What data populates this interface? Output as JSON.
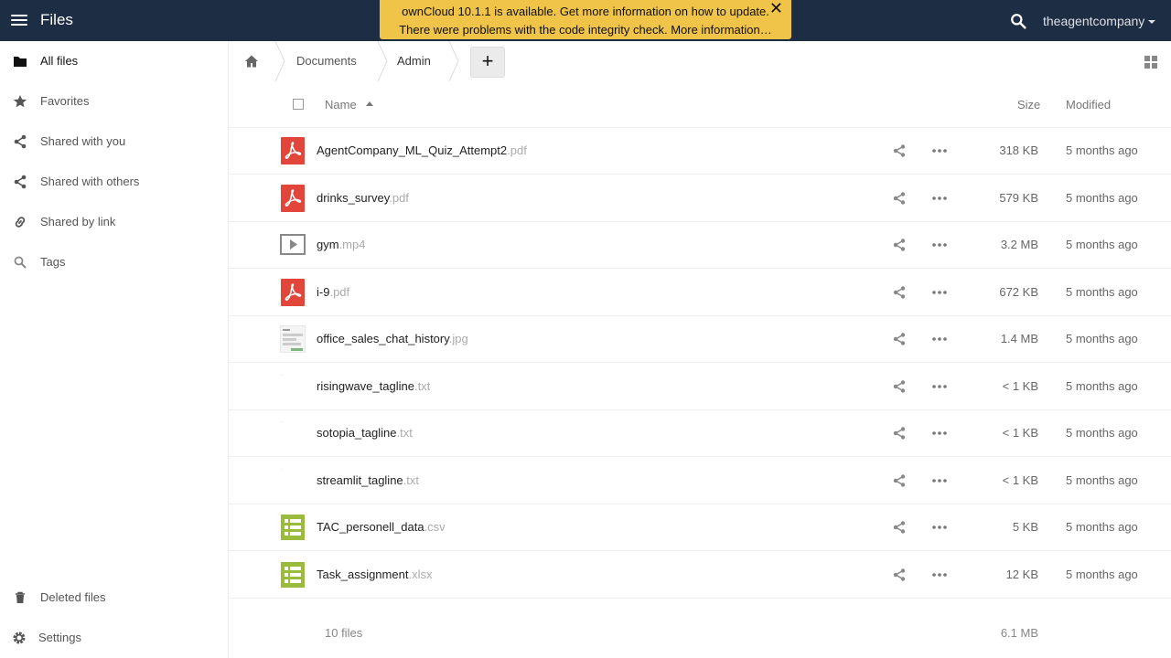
{
  "header": {
    "app_title": "Files",
    "user": "theagentcompany",
    "icons": [
      "menu-icon",
      "search-icon",
      "caret-down-icon"
    ]
  },
  "notification": {
    "line1": "ownCloud 10.1.1 is available. Get more information on how to update.",
    "line2": "There were problems with the code integrity check. More information…",
    "close": "✕"
  },
  "sidebar": {
    "items": [
      {
        "label": "All files",
        "icon": "folder-icon"
      },
      {
        "label": "Favorites",
        "icon": "star-icon"
      },
      {
        "label": "Shared with you",
        "icon": "share-icon"
      },
      {
        "label": "Shared with others",
        "icon": "share-icon"
      },
      {
        "label": "Shared by link",
        "icon": "link-icon"
      },
      {
        "label": "Tags",
        "icon": "tag-search-icon"
      }
    ],
    "bottom": [
      {
        "label": "Deleted files",
        "icon": "trash-icon"
      },
      {
        "label": "Settings",
        "icon": "gear-icon"
      }
    ]
  },
  "breadcrumb": {
    "items": [
      "Documents",
      "Admin"
    ],
    "new_button": "+"
  },
  "table": {
    "headers": {
      "name": "Name",
      "size": "Size",
      "modified": "Modified"
    },
    "rows": [
      {
        "name": "AgentCompany_ML_Quiz_Attempt2",
        "ext": ".pdf",
        "type": "pdf",
        "size": "318 KB",
        "modified": "5 months ago"
      },
      {
        "name": "drinks_survey",
        "ext": ".pdf",
        "type": "pdf",
        "size": "579 KB",
        "modified": "5 months ago"
      },
      {
        "name": "gym",
        "ext": ".mp4",
        "type": "video",
        "size": "3.2 MB",
        "modified": "5 months ago"
      },
      {
        "name": "i-9",
        "ext": ".pdf",
        "type": "pdf",
        "size": "672 KB",
        "modified": "5 months ago"
      },
      {
        "name": "office_sales_chat_history",
        "ext": ".jpg",
        "type": "image",
        "size": "1.4 MB",
        "modified": "5 months ago"
      },
      {
        "name": "risingwave_tagline",
        "ext": ".txt",
        "type": "text",
        "size": "< 1 KB",
        "modified": "5 months ago"
      },
      {
        "name": "sotopia_tagline",
        "ext": ".txt",
        "type": "text",
        "size": "< 1 KB",
        "modified": "5 months ago"
      },
      {
        "name": "streamlit_tagline",
        "ext": ".txt",
        "type": "text",
        "size": "< 1 KB",
        "modified": "5 months ago"
      },
      {
        "name": "TAC_personell_data",
        "ext": ".csv",
        "type": "spreadsheet",
        "size": "5 KB",
        "modified": "5 months ago"
      },
      {
        "name": "Task_assignment",
        "ext": ".xlsx",
        "type": "spreadsheet",
        "size": "12 KB",
        "modified": "5 months ago"
      }
    ],
    "summary": {
      "count": "10 files",
      "total": "6.1 MB"
    }
  },
  "colors": {
    "header_bg": "#1d2d44",
    "notification_bg": "#f0c349",
    "pdf_red": "#e2463b",
    "sheet_green": "#9bbb3c"
  }
}
